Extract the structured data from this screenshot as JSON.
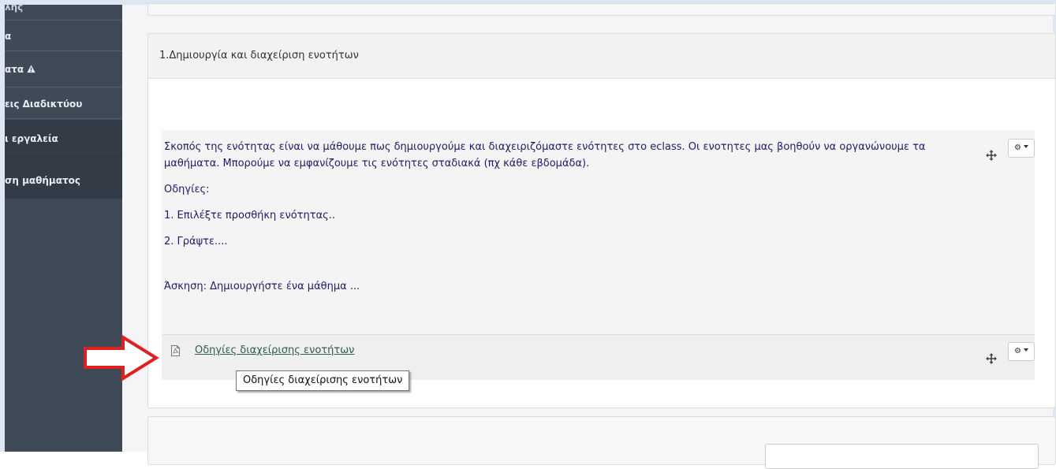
{
  "sidebar": {
    "items": [
      {
        "label": "λης"
      },
      {
        "label": "α"
      },
      {
        "label": "ατα"
      },
      {
        "label": "εις Διαδικτύου"
      },
      {
        "label": "ι εργαλεία"
      },
      {
        "label": "ση μαθήματος"
      }
    ]
  },
  "section": {
    "title": "1.Δημιουργία και διαχείριση ενοτήτων",
    "description": [
      "Σκοπός της ενότητας είναι να μάθουμε πως δημιουργούμε και διαχειριζόμαστε ενότητες στο eclass. Οι ενοτητες μας βοηθούν να οργανώνουμε τα μαθήματα. Μπορούμε να εμφανίζουμε τις ενότητες σταδιακά (πχ κάθε εβδομάδα).",
      "Οδηγίες:",
      "1. Επιλέξτε προσθήκη ενότητας..",
      "2. Γράψτε....",
      "Άσκηση: Δημιουργήστε  ένα μάθημα ..."
    ],
    "resource": {
      "link_text": "Οδηγίες διαχείρισης ενοτήτων",
      "tooltip": "Οδηγίες διαχείρισης ενοτήτων"
    }
  },
  "colors": {
    "sidebar": "#3f4a57",
    "sidebar_active": "#323b46",
    "description_text": "#1c1c6e",
    "link": "#2e5e46",
    "arrow": "#e02020"
  },
  "icons": [
    "warning-icon",
    "move-icon",
    "gear-icon",
    "pdf-file-icon",
    "red-arrow-annotation"
  ]
}
